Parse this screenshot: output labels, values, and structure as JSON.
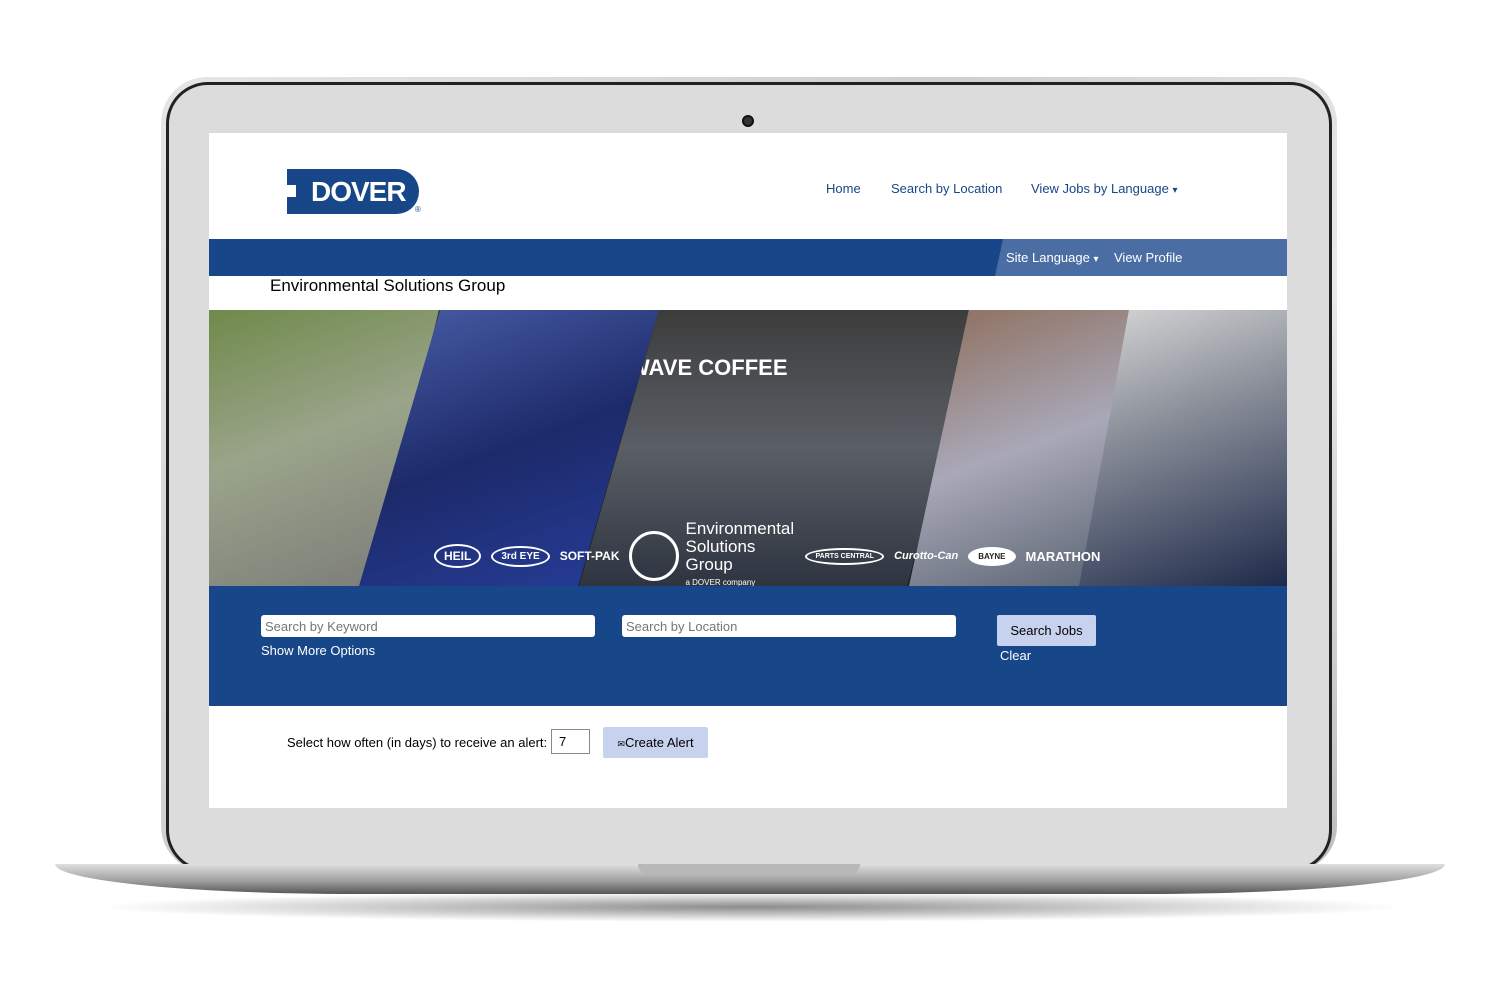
{
  "brand": {
    "logo_text": "DOVER",
    "registered": "®"
  },
  "nav": {
    "home": "Home",
    "search_location": "Search by Location",
    "jobs_language": "View Jobs by Language",
    "caret": "▾"
  },
  "subnav": {
    "site_language": "Site Language",
    "view_profile": "View Profile"
  },
  "page_title": "Environmental Solutions Group",
  "banner": {
    "logos": [
      "HEIL",
      "3rd EYE",
      "SOFT-PAK",
      "Environmental Solutions Group",
      "a DOVER company",
      "PARTS CENTRAL",
      "Curotto-Can",
      "BAYNE",
      "MARATHON"
    ],
    "sign_text": "WAVE COFFEE"
  },
  "search": {
    "keyword_placeholder": "Search by Keyword",
    "location_placeholder": "Search by Location",
    "more_options": "Show More Options",
    "search_button": "Search Jobs",
    "clear": "Clear"
  },
  "alert": {
    "label": "Select how often (in days) to receive an alert:",
    "days": "7",
    "icon": "✉",
    "button": "Create Alert"
  },
  "colors": {
    "brand_blue": "#174689",
    "bar_light": "#4a6ea3",
    "button": "#c7d3ee"
  }
}
